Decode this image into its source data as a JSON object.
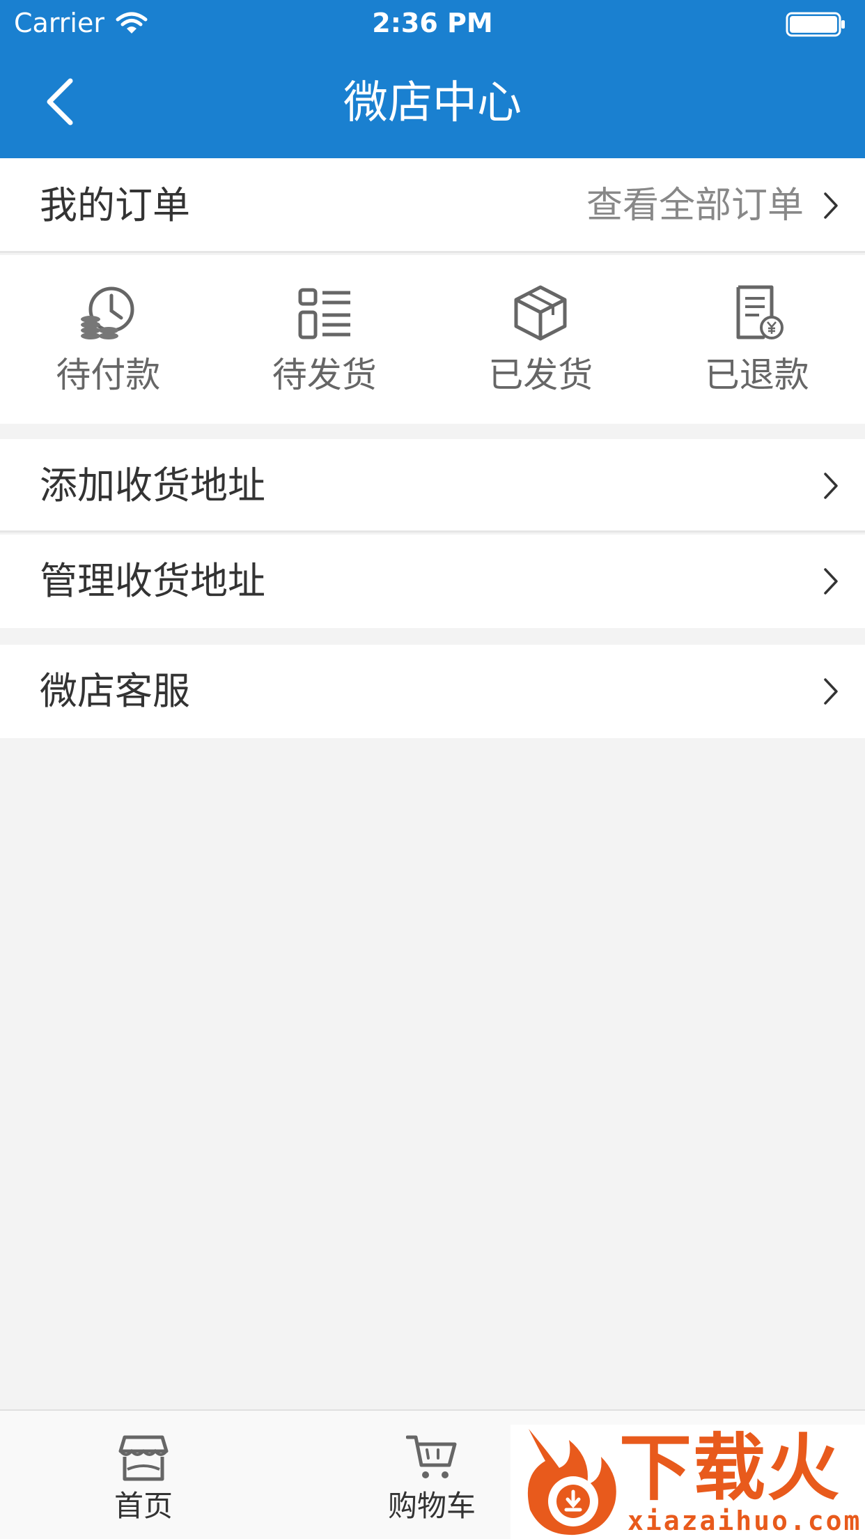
{
  "status_bar": {
    "carrier": "Carrier",
    "time": "2:36 PM"
  },
  "nav": {
    "title": "微店中心",
    "back_icon": "chevron-left-icon"
  },
  "orders": {
    "label": "我的订单",
    "view_all": "查看全部订单"
  },
  "order_status": [
    {
      "label": "待付款",
      "icon": "clock-coins-icon"
    },
    {
      "label": "待发货",
      "icon": "list-icon"
    },
    {
      "label": "已发货",
      "icon": "box-icon"
    },
    {
      "label": "已退款",
      "icon": "refund-doc-icon"
    }
  ],
  "menu": {
    "add_address": "添加收货地址",
    "manage_address": "管理收货地址",
    "service": "微店客服"
  },
  "tabs": [
    {
      "label": "首页",
      "icon": "store-icon"
    },
    {
      "label": "购物车",
      "icon": "cart-icon"
    }
  ],
  "watermark": {
    "brand": "下载火",
    "url": "xiazaihuo.com"
  },
  "colors": {
    "primary": "#1a80d0",
    "background": "#f3f3f3",
    "watermark": "#e85a1c"
  }
}
